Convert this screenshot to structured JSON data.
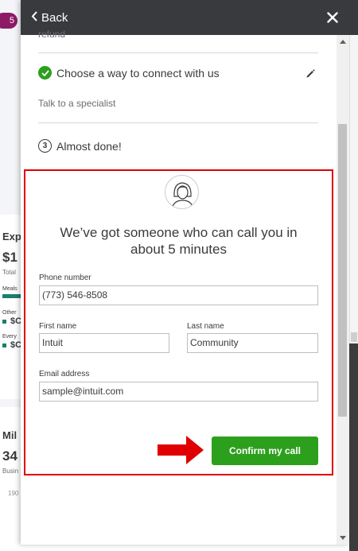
{
  "background": {
    "badge": "5",
    "card1": {
      "title": "Exp",
      "amount": "$1",
      "caption": "Total",
      "rows": [
        "Meals",
        "Other",
        "Every"
      ],
      "amounts": [
        "$C",
        "$C"
      ]
    },
    "card2": {
      "title": "Mil",
      "amount": "34",
      "caption": "Busin",
      "tick": "190"
    }
  },
  "panel": {
    "back_label": "Back",
    "cutoff_text": "refund",
    "step_done": {
      "label": "Choose a way to connect with us",
      "detail": "Talk to a specialist"
    },
    "step_current": {
      "number": "3",
      "label": "Almost done!"
    },
    "callbox": {
      "title_line1": "We’ve got someone who can call you in",
      "title_line2": "about 5 minutes",
      "phone": {
        "label": "Phone number",
        "value": "(773) 546-8508"
      },
      "first_name": {
        "label": "First name",
        "value": "Intuit"
      },
      "last_name": {
        "label": "Last name",
        "value": "Community"
      },
      "email": {
        "label": "Email address",
        "value": "sample@intuit.com"
      },
      "confirm_label": "Confirm my call"
    }
  },
  "colors": {
    "accent_green": "#2ca01c",
    "header": "#393a3d",
    "highlight_red": "#e00000",
    "badge": "#8d1a66"
  },
  "icons": [
    "chevron-left-icon",
    "close-icon",
    "check-circle-icon",
    "pencil-icon",
    "step-number-icon",
    "agent-avatar-icon",
    "red-arrow-icon"
  ]
}
